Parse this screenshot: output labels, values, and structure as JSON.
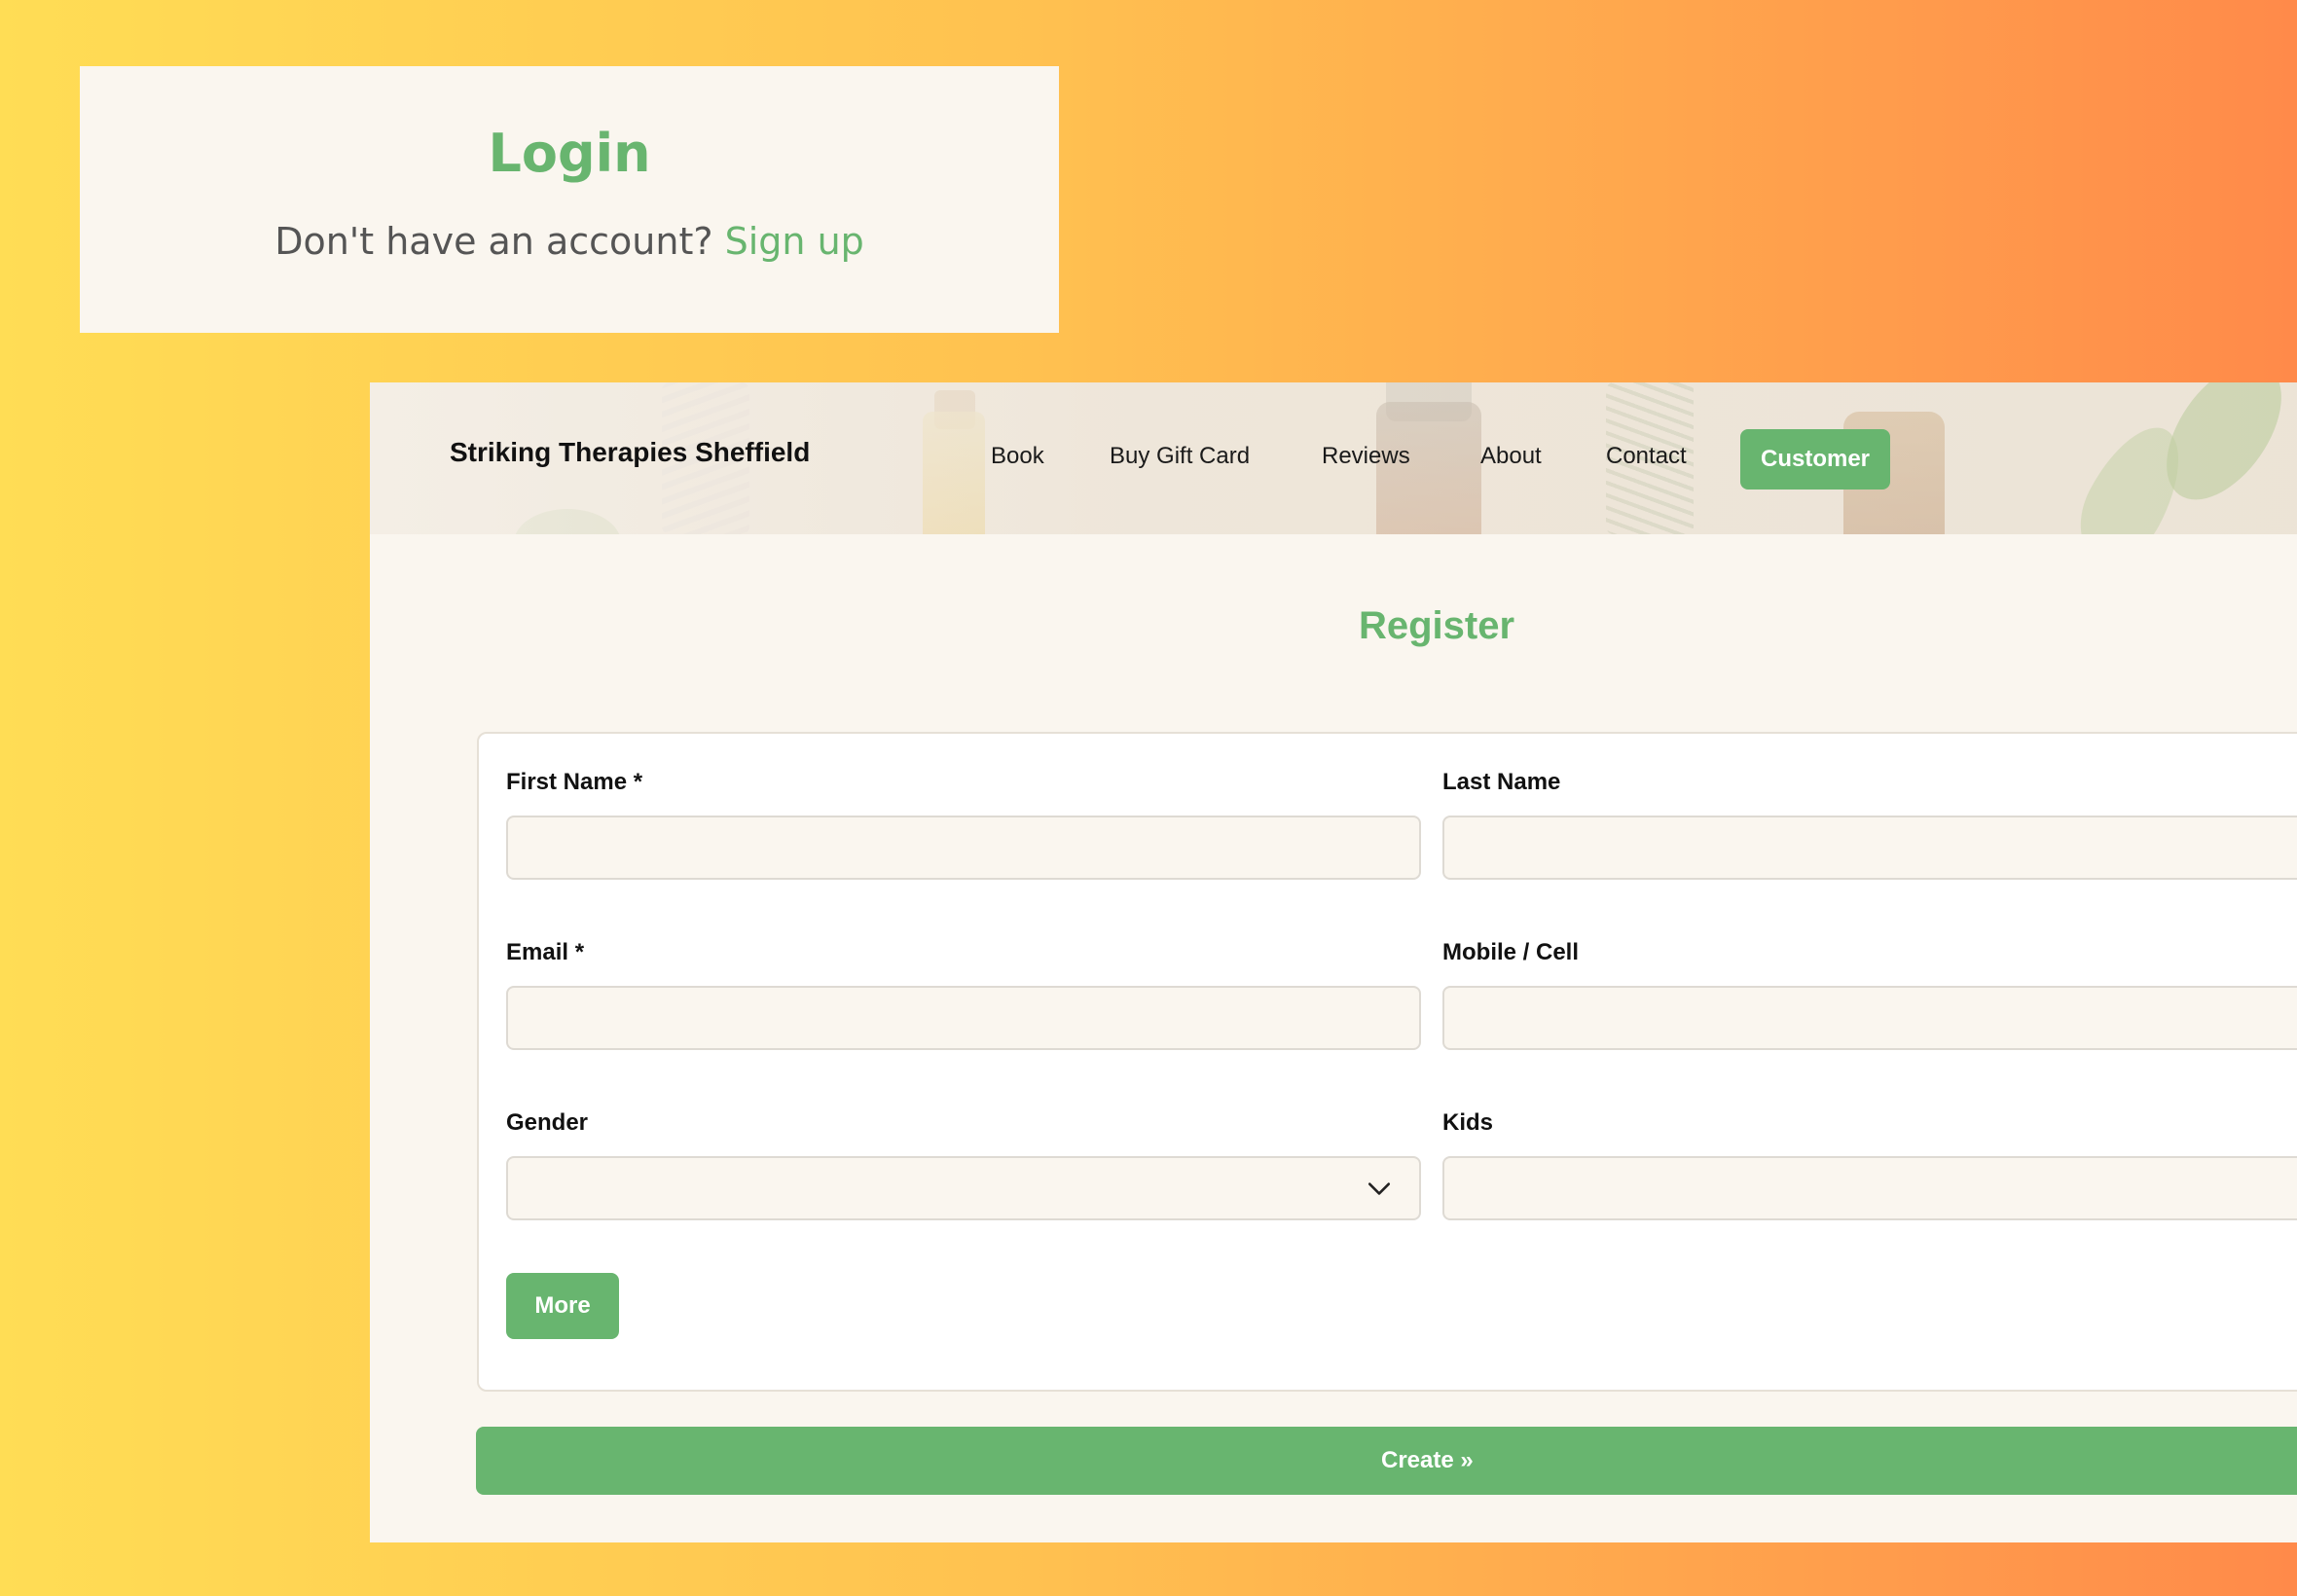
{
  "login": {
    "title": "Login",
    "prompt": "Don't have an account?",
    "signup_link": "Sign up"
  },
  "header": {
    "brand": "Striking Therapies Sheffield",
    "nav": [
      {
        "label": "Book"
      },
      {
        "label": "Buy Gift Card"
      },
      {
        "label": "Reviews"
      },
      {
        "label": "About"
      },
      {
        "label": "Contact"
      }
    ],
    "customer_button": "Customer"
  },
  "register": {
    "title": "Register",
    "fields": {
      "first_name": {
        "label": "First Name *",
        "value": ""
      },
      "last_name": {
        "label": "Last Name",
        "value": ""
      },
      "email": {
        "label": "Email *",
        "value": ""
      },
      "mobile": {
        "label": "Mobile / Cell",
        "value": ""
      },
      "gender": {
        "label": "Gender",
        "value": ""
      },
      "kids": {
        "label": "Kids",
        "value": ""
      }
    },
    "more_button": "More",
    "create_button": "Create »"
  },
  "colors": {
    "accent": "#68b56f",
    "panel_bg": "#faf6ef",
    "background_gradient": [
      "#ffdd55",
      "#ff8a4a"
    ]
  },
  "icons": {
    "gender_select": "chevron-down-icon"
  }
}
